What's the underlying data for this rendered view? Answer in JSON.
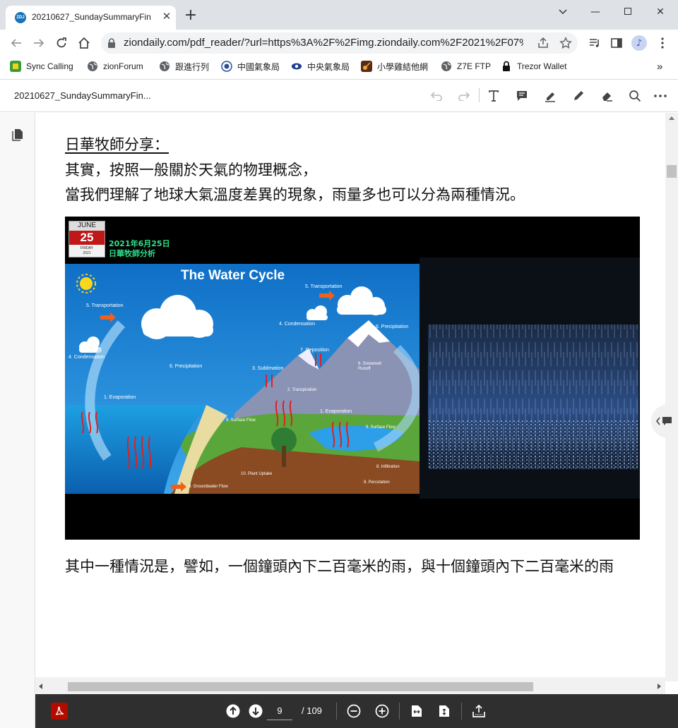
{
  "browser": {
    "tab_title": "20210627_SundaySummaryFin",
    "favicon_text": "ZDJ",
    "url": "ziondaily.com/pdf_reader/?url=https%3A%2F%2Fimg.ziondaily.com%2F2021%2F07%...",
    "bookmarks": [
      {
        "label": "Sync Calling",
        "icon": "sync-calling-icon"
      },
      {
        "label": "zionForum",
        "icon": "globe-icon"
      },
      {
        "label": "跟進行列",
        "icon": "globe-icon"
      },
      {
        "label": "中國氣象局",
        "icon": "weather-icon"
      },
      {
        "label": "中央氣象局",
        "icon": "weather-eye-icon"
      },
      {
        "label": "小學雞結他網",
        "icon": "guitar-icon"
      },
      {
        "label": "Z7E FTP",
        "icon": "globe-icon"
      },
      {
        "label": "Trezor Wallet",
        "icon": "lock-icon"
      }
    ],
    "more_bookmarks": "»"
  },
  "pdf": {
    "filename": "20210627_SundaySummaryFin...",
    "heading": "日華牧師分享：",
    "line1": "其實，按照一般關於天氣的物理概念，",
    "line2": "當我們理解了地球大氣溫度差異的現象，雨量多也可以分為兩種情況。",
    "line3": "其中一種情況是，譬如，一個鐘頭內下二百毫米的雨，與十個鐘頭內下二百毫米的雨",
    "figure": {
      "calendar_month": "JUNE",
      "calendar_day": "25",
      "calendar_weekday": "FRIDAY",
      "calendar_year": "2021",
      "date_text": "2021年6月25日",
      "caption": "日華牧師分析",
      "diagram_title": "The Water Cycle",
      "labels": {
        "transportation_left": "5. Transportation",
        "transportation_top": "5. Transportation",
        "condensation_left": "4. Condensation",
        "condensation_mid": "4. Condensation",
        "precipitation_left": "6. Precipitation",
        "precipitation_right": "6. Precipitation",
        "deposition": "7. Deposition",
        "sublimation": "3. Sublimation",
        "snowmelt": "9. Snowmelt Runoff",
        "transpiration": "2. Transpiration",
        "evaporation_left": "1. Evaporation",
        "evaporation_right": "1. Evaporation",
        "surface_flow_left": "9. Surface Flow",
        "surface_flow_right": "9. Surface Flow",
        "infiltration": "8. Infiltration",
        "plant_uptake": "10. Plant Uptake",
        "percolation": "8. Percolation",
        "groundwater": "9. Groundwater Flow"
      }
    },
    "page_current": "9",
    "page_total": "/ 109"
  },
  "colors": {
    "tabstrip": "#dee1e6",
    "pdf_bottom_bar": "#2f2f2f",
    "acrobat_red": "#b30b00",
    "diagram_sky": "#1e88d6"
  }
}
